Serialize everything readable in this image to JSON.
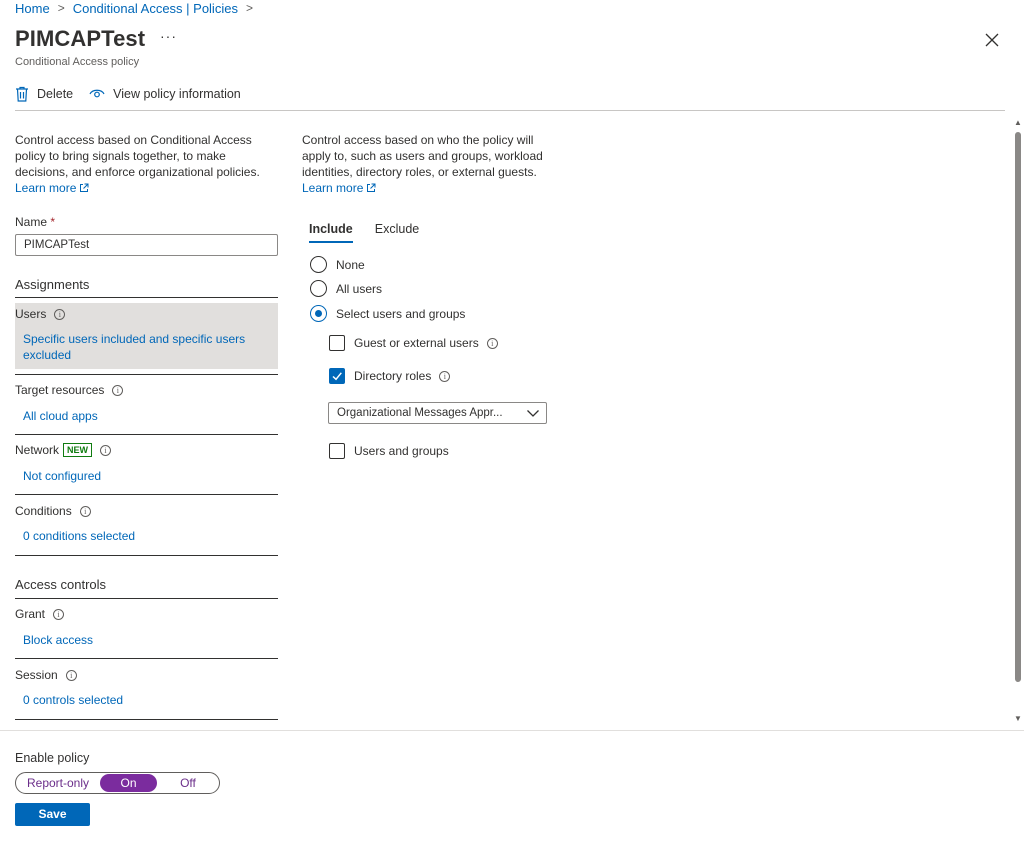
{
  "breadcrumb": {
    "home": "Home",
    "parent": "Conditional Access | Policies"
  },
  "header": {
    "title": "PIMCAPTest",
    "more": "···",
    "subtitle": "Conditional Access policy"
  },
  "toolbar": {
    "delete_label": "Delete",
    "view_info_label": "View policy information"
  },
  "left": {
    "description": "Control access based on Conditional Access policy to bring signals together, to make decisions, and enforce organizational policies.",
    "learn_more": "Learn more",
    "name_label": "Name",
    "name_required": "*",
    "name_value": "PIMCAPTest",
    "assignments_heading": "Assignments",
    "users_label": "Users",
    "users_value": "Specific users included and specific users excluded",
    "target_label": "Target resources",
    "target_value": "All cloud apps",
    "network_label": "Network",
    "network_badge": "NEW",
    "network_value": "Not configured",
    "conditions_label": "Conditions",
    "conditions_value": "0 conditions selected",
    "access_heading": "Access controls",
    "grant_label": "Grant",
    "grant_value": "Block access",
    "session_label": "Session",
    "session_value": "0 controls selected"
  },
  "right": {
    "description": "Control access based on who the policy will apply to, such as users and groups, workload identities, directory roles, or external guests.",
    "learn_more": "Learn more",
    "tabs": [
      "Include",
      "Exclude"
    ],
    "radios": [
      "None",
      "All users",
      "Select users and groups"
    ],
    "selected_radio": "Select users and groups",
    "checkbox_guest": "Guest or external users",
    "checkbox_roles": "Directory roles",
    "roles_dropdown": "Organizational Messages Appr...",
    "checkbox_users_groups": "Users and groups"
  },
  "footer": {
    "enable_label": "Enable policy",
    "options": [
      "Report-only",
      "On",
      "Off"
    ],
    "selected": "On",
    "save_label": "Save"
  },
  "colors": {
    "accent": "#0067b8",
    "toggle_on": "#7b2c9e",
    "new_badge": "#107c10"
  }
}
